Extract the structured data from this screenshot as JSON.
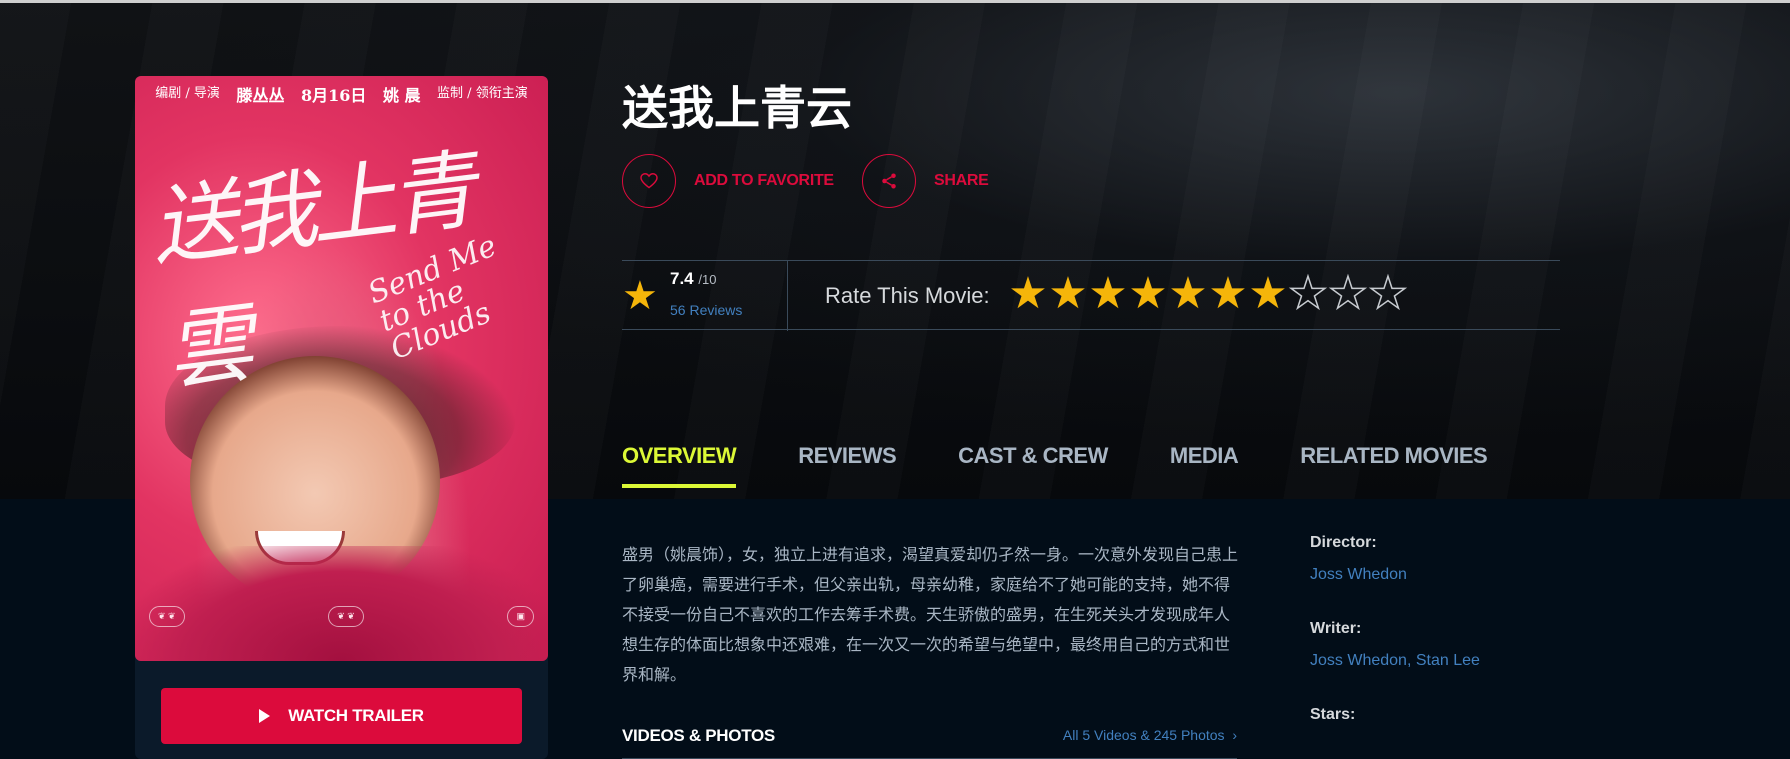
{
  "movie": {
    "title": "送我上青云",
    "poster": {
      "credits": [
        "编剧 / 导演",
        "滕丛丛",
        "8月16日",
        "姚 晨",
        "监制 / 领衔主演"
      ],
      "title_art": "送我上青雲",
      "subtitle_art": "Send Me to the Clouds"
    }
  },
  "actions": {
    "favorite_label": "ADD TO FAVORITE",
    "share_label": "SHARE"
  },
  "rating": {
    "score": "7.4",
    "max": "/10",
    "reviews": "56 Reviews",
    "rate_label": "Rate This Movie:",
    "filled_stars": 7,
    "total_stars": 10
  },
  "tabs": [
    "OVERVIEW",
    "REVIEWS",
    "CAST & CREW",
    "MEDIA",
    "RELATED MOVIES"
  ],
  "overview": {
    "text": "盛男（姚晨饰），女，独立上进有追求，渴望真爱却仍孑然一身。一次意外发现自己患上了卵巢癌，需要进行手术，但父亲出轨，母亲幼稚，家庭给不了她可能的支持，她不得不接受一份自己不喜欢的工作去筹手术费。天生骄傲的盛男，在生死关头才发现成年人想生存的体面比想象中还艰难，在一次又一次的希望与绝望中，最终用自己的方式和世界和解。"
  },
  "videos_photos": {
    "title": "VIDEOS & PHOTOS",
    "link": "All 5 Videos & 245 Photos"
  },
  "sidebar": {
    "director_label": "Director:",
    "director": "Joss Whedon",
    "writer_label": "Writer:",
    "writer": "Joss Whedon, Stan Lee",
    "stars_label": "Stars:"
  },
  "trailer": {
    "label": "WATCH TRAILER"
  },
  "colors": {
    "accent": "#dc0b3c",
    "tab_active": "#dcf836",
    "link": "#4280bf",
    "star": "#f5b50a"
  }
}
